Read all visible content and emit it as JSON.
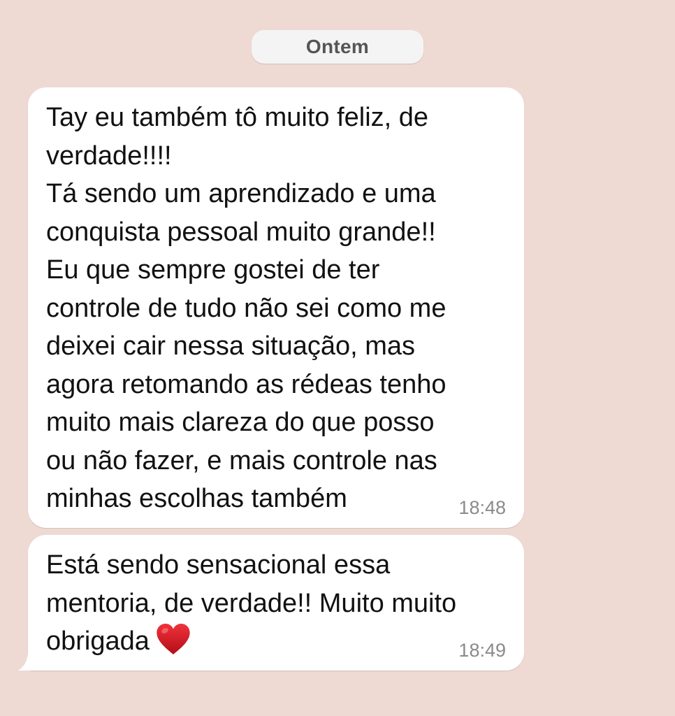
{
  "date_separator": {
    "label": "Ontem"
  },
  "messages": [
    {
      "text": "Tay eu também tô muito feliz, de verdade!!!!\nTá sendo um aprendizado e uma conquista pessoal muito grande!! Eu que sempre gostei de ter controle de tudo não sei como me deixei cair nessa situação, mas agora retomando as rédeas tenho muito mais clareza do que posso ou não fazer, e mais controle nas minhas escolhas também",
      "time": "18:48"
    },
    {
      "text": "Está sendo sensacional essa mentoria, de verdade!! Muito muito obrigada",
      "emoji": "heart-icon",
      "time": "18:49"
    }
  ],
  "colors": {
    "background": "#eed9d3",
    "bubble": "#ffffff",
    "timestamp": "#8a8a8a",
    "heart": "#d2141e"
  }
}
